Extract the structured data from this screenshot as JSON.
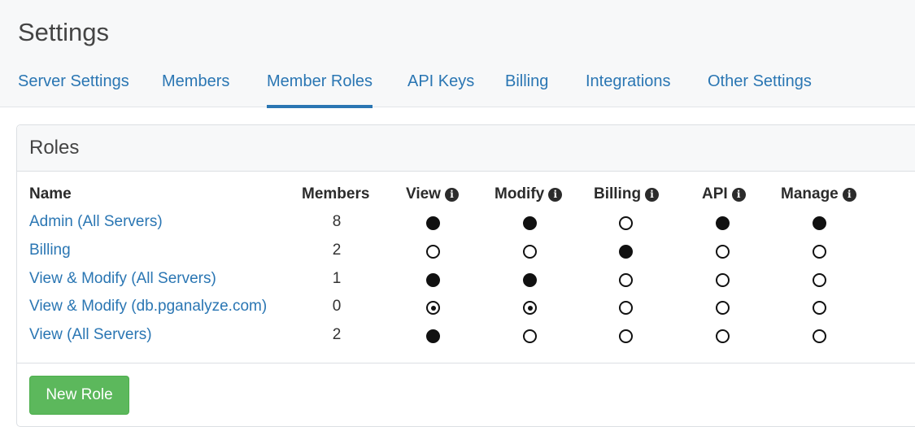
{
  "page_title": "Settings",
  "tabs": [
    {
      "label": "Server Settings",
      "active": false
    },
    {
      "label": "Members",
      "active": false
    },
    {
      "label": "Member Roles",
      "active": true
    },
    {
      "label": "API Keys",
      "active": false
    },
    {
      "label": "Billing",
      "active": false
    },
    {
      "label": "Integrations",
      "active": false
    },
    {
      "label": "Other Settings",
      "active": false
    }
  ],
  "panel": {
    "title": "Roles",
    "columns": {
      "name": "Name",
      "members": "Members",
      "view": "View",
      "modify": "Modify",
      "billing": "Billing",
      "api": "API",
      "manage": "Manage"
    },
    "info_icon": "info-circle-icon",
    "rows": [
      {
        "name": "Admin (All Servers)",
        "members": "8",
        "permissions": [
          "full",
          "full",
          "none",
          "full",
          "full"
        ]
      },
      {
        "name": "Billing",
        "members": "2",
        "permissions": [
          "none",
          "none",
          "full",
          "none",
          "none"
        ]
      },
      {
        "name": "View & Modify (All Servers)",
        "members": "1",
        "permissions": [
          "full",
          "full",
          "none",
          "none",
          "none"
        ]
      },
      {
        "name": "View & Modify (db.pganalyze.com)",
        "members": "0",
        "permissions": [
          "partial",
          "partial",
          "none",
          "none",
          "none"
        ]
      },
      {
        "name": "View (All Servers)",
        "members": "2",
        "permissions": [
          "full",
          "none",
          "none",
          "none",
          "none"
        ]
      }
    ],
    "new_role_label": "New Role"
  },
  "colors": {
    "link": "#2a76b3",
    "button_green": "#5cb85c"
  }
}
